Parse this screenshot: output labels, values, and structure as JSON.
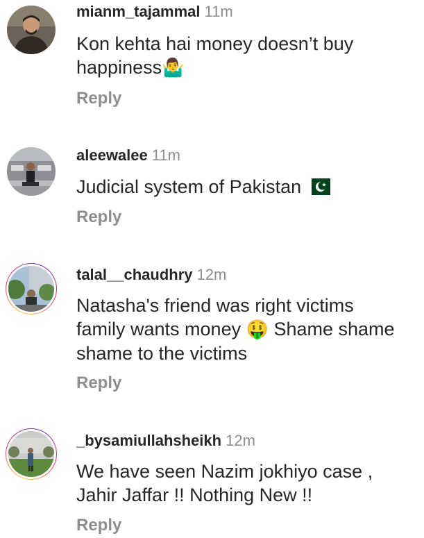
{
  "comments": [
    {
      "username": "mianm_tajammal",
      "time": "11m",
      "text": "Kon kehta hai money doesn’t buy\nhappiness",
      "emoji": "🤷‍♂️",
      "reply": "Reply"
    },
    {
      "username": "aleewalee",
      "time": "11m",
      "text": "Judicial system of Pakistan",
      "emoji": "🇵🇰",
      "reply": "Reply"
    },
    {
      "username": "talal__chaudhry",
      "time": "12m",
      "text_before": "Natasha's friend was right victims\nfamily wants money ",
      "emoji": "🤑",
      "text_after": " Shame shame\nshame to the victims",
      "reply": "Reply"
    },
    {
      "username": "_bysamiullahsheikh",
      "time": "12m",
      "text": "We have seen Nazim jokhiyo case ,\nJahir Jaffar !! Nothing New !!",
      "reply": "Reply"
    }
  ],
  "colors": {
    "text": "#262626",
    "secondary": "#8e8e8e",
    "story_ring": [
      "#f9ce34",
      "#ee2a7b",
      "#6228d7"
    ]
  }
}
